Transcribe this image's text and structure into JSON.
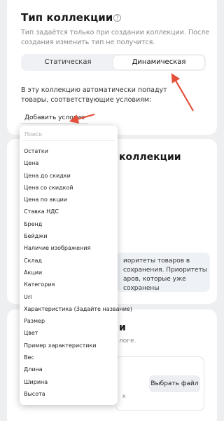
{
  "collection_type": {
    "title": "Тип коллекции",
    "help_icon": "question-circle-icon",
    "hint": "Тип задаётся только при создании коллекции. После создания изменить тип не получится.",
    "tabs": [
      {
        "label": "Статическая",
        "active": false
      },
      {
        "label": "Динамическая",
        "active": true
      }
    ],
    "auto_text": "В эту коллекцию автоматически попадут товары, соответствующие условиям:",
    "add_condition_label": "Добавить условие"
  },
  "dropdown": {
    "search_placeholder": "Поиск",
    "options": [
      "Остатки",
      "Цена",
      "Цена до скидки",
      "Цена со скидкой",
      "Цена по акции",
      "Ставка НДС",
      "Бренд",
      "Бейджи",
      "Наличие изображения",
      "Склад",
      "Акции",
      "Категория",
      "Url",
      "Характеристика (Задайте название)",
      "Размер",
      "Цвет",
      "Пример характеристики",
      "Вес",
      "Длина",
      "Ширина",
      "Высота"
    ]
  },
  "card2": {
    "title_fragment": "коллекции",
    "info_text": "иоритеты товаров в сохранения. Приоритеты аров, которые уже сохранены"
  },
  "card3": {
    "title_fragment": "и",
    "subtitle_fragment": "логе.",
    "upload_button": "Выбрать файл",
    "small_text_fragment": "к"
  },
  "colors": {
    "background": "#eeeff1",
    "card": "#ffffff",
    "arrow": "#e5503a",
    "segment_bg": "#f0f1f4"
  }
}
